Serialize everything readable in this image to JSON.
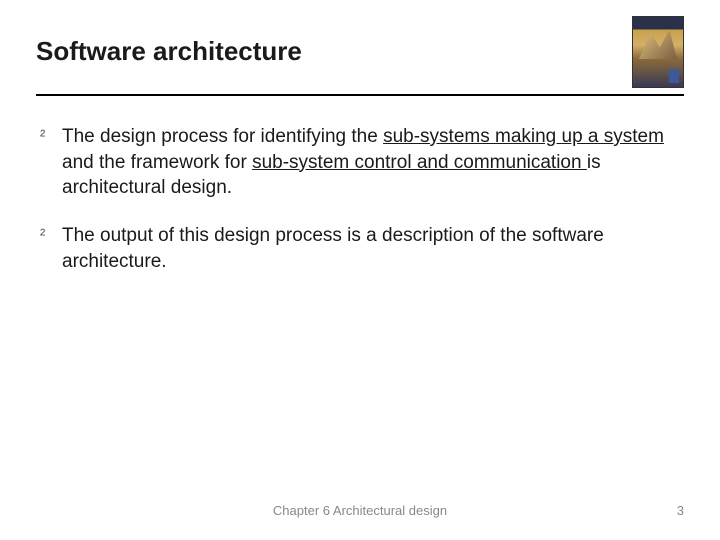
{
  "title": "Software architecture",
  "bullets": [
    {
      "segments": [
        {
          "text": "The design process for identifying the ",
          "underline": false
        },
        {
          "text": "sub-systems making up a system",
          "underline": true
        },
        {
          "text": " and the framework for ",
          "underline": false
        },
        {
          "text": "sub-system control and communication ",
          "underline": true
        },
        {
          "text": "is architectural design.",
          "underline": false
        }
      ]
    },
    {
      "segments": [
        {
          "text": "The output of this design process is a description of the software architecture.",
          "underline": false
        }
      ]
    }
  ],
  "footer": "Chapter 6 Architectural design",
  "page_number": "3",
  "bullet_glyph": "²"
}
